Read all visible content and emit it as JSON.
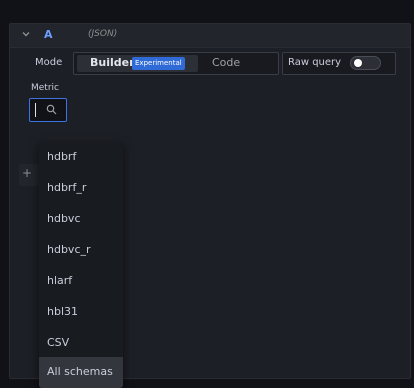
{
  "query": {
    "name": "A",
    "type_label": "(JSON)"
  },
  "mode": {
    "label": "Mode",
    "builder_label": "Builder",
    "experimental_badge": "Experimental",
    "code_label": "Code",
    "selected": "Builder"
  },
  "raw_query": {
    "label": "Raw query",
    "enabled": false
  },
  "metric": {
    "label": "Metric",
    "search_value": "",
    "options": [
      "hdbrf",
      "hdbrf_r",
      "hdbvc",
      "hdbvc_r",
      "hlarf",
      "hbl31",
      "CSV",
      "All schemas"
    ],
    "highlighted": "All schemas"
  },
  "colors": {
    "accent": "#6e9fff",
    "badge": "#2f6ad6",
    "focus_border": "#3b74e0"
  },
  "icons": [
    "chevron-down-icon",
    "search-icon"
  ]
}
